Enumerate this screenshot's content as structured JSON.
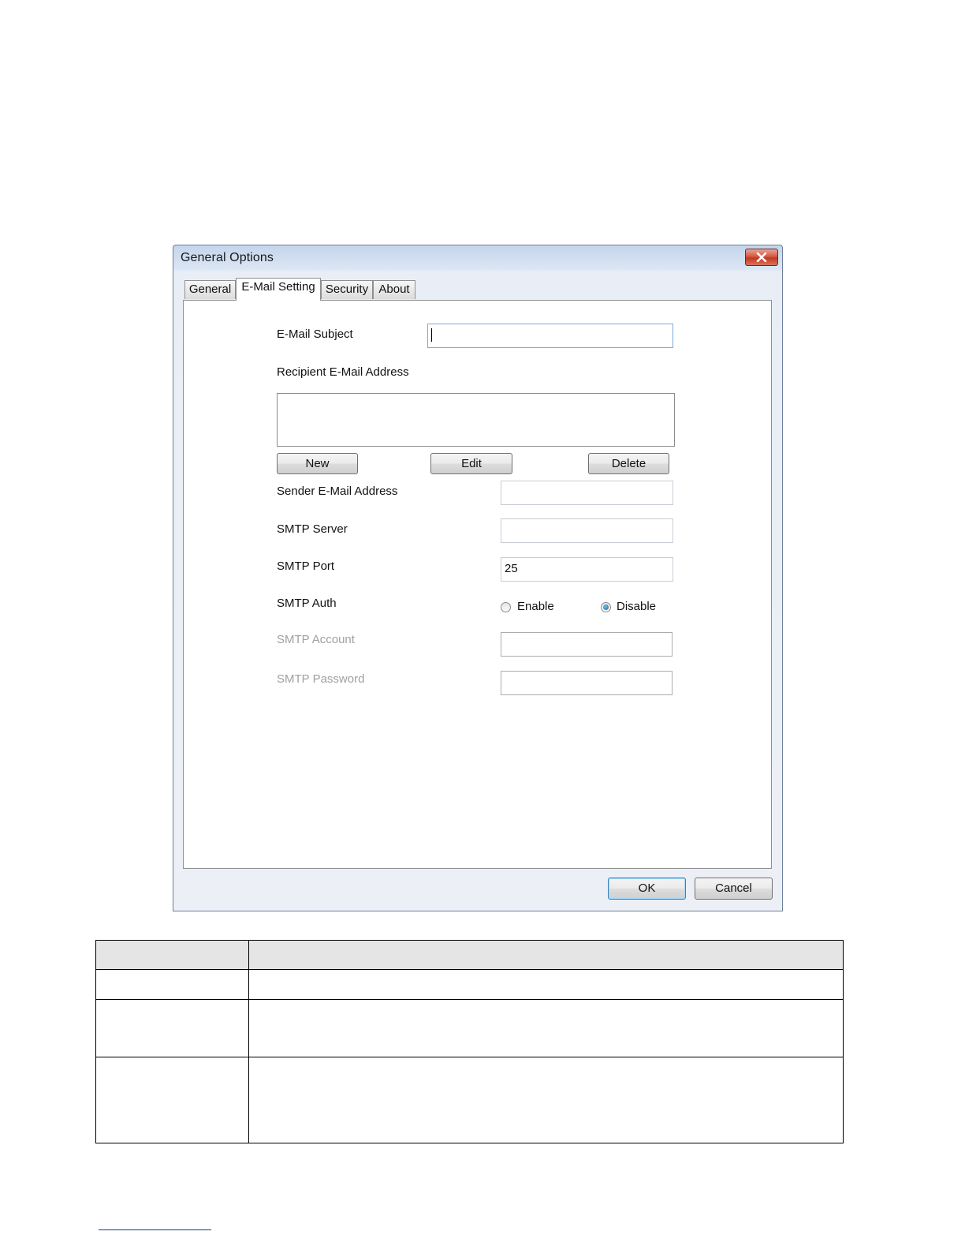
{
  "dialog": {
    "title": "General Options",
    "tabs": [
      {
        "label": "General",
        "active": false
      },
      {
        "label": "E-Mail Setting",
        "active": true
      },
      {
        "label": "Security",
        "active": false
      },
      {
        "label": "About",
        "active": false
      }
    ],
    "email_subject": {
      "label": "E-Mail Subject",
      "value": ""
    },
    "recipient": {
      "label": "Recipient E-Mail Address",
      "items": []
    },
    "list_buttons": {
      "new": "New",
      "edit": "Edit",
      "delete": "Delete"
    },
    "sender": {
      "label": "Sender E-Mail Address",
      "value": ""
    },
    "smtp_server": {
      "label": "SMTP Server",
      "value": ""
    },
    "smtp_port": {
      "label": "SMTP Port",
      "value": "25"
    },
    "smtp_auth": {
      "label": "SMTP Auth",
      "options": [
        "Enable",
        "Disable"
      ],
      "selected": "Disable"
    },
    "smtp_account": {
      "label": "SMTP Account",
      "value": "",
      "enabled": false
    },
    "smtp_password": {
      "label": "SMTP Password",
      "value": "",
      "enabled": false
    },
    "ok_label": "OK",
    "cancel_label": "Cancel"
  },
  "colors": {
    "titlebar": "#c4d5ec",
    "close_button": "#c23a22",
    "disabled_text": "#a0a0a0",
    "focus_border": "#7fa9d6"
  },
  "icons": [
    "close-icon",
    "radio-button"
  ],
  "table": {
    "header": [
      "",
      ""
    ],
    "rows": [
      [
        "",
        ""
      ],
      [
        "",
        ""
      ],
      [
        "",
        ""
      ]
    ]
  }
}
